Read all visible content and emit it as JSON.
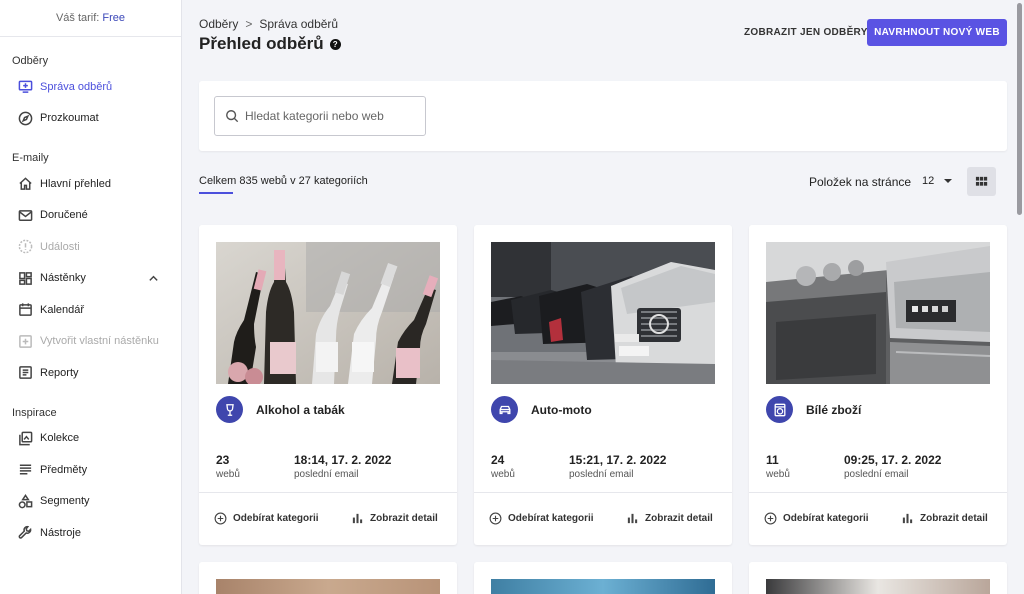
{
  "sidebar": {
    "plan_label": "Váš tarif:",
    "plan_name": "Free",
    "sections": [
      {
        "title": "Odběry",
        "items": [
          {
            "label": "Správa odběrů",
            "icon": "add-screen-icon",
            "state": "active"
          },
          {
            "label": "Prozkoumat",
            "icon": "compass-icon",
            "state": "normal"
          }
        ]
      },
      {
        "title": "E-maily",
        "items": [
          {
            "label": "Hlavní přehled",
            "icon": "home-icon",
            "state": "normal"
          },
          {
            "label": "Doručené",
            "icon": "mail-icon",
            "state": "normal"
          },
          {
            "label": "Události",
            "icon": "alert-icon",
            "state": "disabled"
          },
          {
            "label": "Nástěnky",
            "icon": "dashboard-icon",
            "state": "normal"
          },
          {
            "label": "Kalendář",
            "icon": "calendar-icon",
            "state": "normal"
          },
          {
            "label": "Vytvořit vlastní nástěnku",
            "icon": "add-box-icon",
            "state": "disabled"
          },
          {
            "label": "Reporty",
            "icon": "report-icon",
            "state": "normal"
          }
        ]
      },
      {
        "title": "Inspirace",
        "items": [
          {
            "label": "Kolekce",
            "icon": "collection-icon",
            "state": "normal"
          },
          {
            "label": "Předměty",
            "icon": "subject-lines-icon",
            "state": "normal"
          },
          {
            "label": "Segmenty",
            "icon": "segments-icon",
            "state": "normal"
          },
          {
            "label": "Nástroje",
            "icon": "wrench-icon",
            "state": "normal"
          }
        ]
      }
    ]
  },
  "header": {
    "breadcrumb": [
      "Odběry",
      "Správa odběrů"
    ],
    "title": "Přehled odběrů",
    "show_only_label": "ZOBRAZIT JEN ODBĚRY",
    "suggest_label": "NAVRHNOUT NOVÝ WEB"
  },
  "search": {
    "placeholder": "Hledat kategorii nebo web"
  },
  "summary": {
    "total_text": "Celkem 835 webů v 27 kategoriích",
    "per_page_label": "Položek na stránce",
    "per_page_value": "12"
  },
  "cards": [
    {
      "name": "Alkohol a tabák",
      "icon": "wine-glass-icon",
      "count": "23",
      "count_label": "webů",
      "date": "18:14, 17. 2. 2022",
      "date_label": "poslední email",
      "subscribe": "Odebírat kategorii",
      "detail": "Zobrazit detail"
    },
    {
      "name": "Auto-moto",
      "icon": "car-icon",
      "count": "24",
      "count_label": "webů",
      "date": "15:21, 17. 2. 2022",
      "date_label": "poslední email",
      "subscribe": "Odebírat kategorii",
      "detail": "Zobrazit detail"
    },
    {
      "name": "Bílé zboží",
      "icon": "washing-machine-icon",
      "count": "11",
      "count_label": "webů",
      "date": "09:25, 17. 2. 2022",
      "date_label": "poslední email",
      "subscribe": "Odebírat kategorii",
      "detail": "Zobrazit detail"
    }
  ],
  "colors": {
    "accent": "#5a53e3",
    "active_nav": "#4b4fdc",
    "category_icon_bg": "#3f46ad"
  }
}
